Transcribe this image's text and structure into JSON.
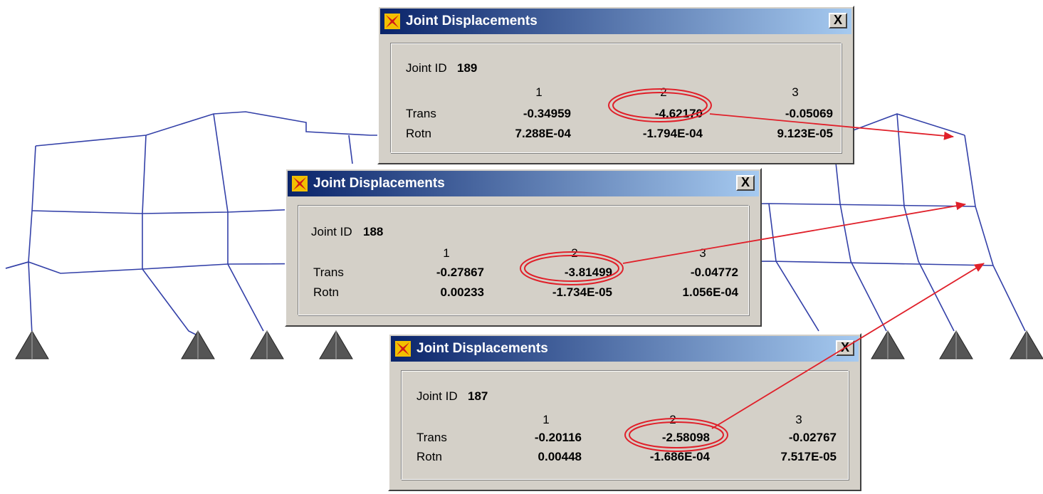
{
  "colors": {
    "frame_line": "#3340a8",
    "support": "#555555",
    "arrow": "#e0202a",
    "dialog_bg": "#d4d0c8",
    "title_start": "#0a246a",
    "title_end": "#a6caf0"
  },
  "icons": {
    "app": "sap2000-app-icon",
    "close": "close-icon"
  },
  "dialogs": [
    {
      "title": "Joint Displacements",
      "close_label": "X",
      "joint_label": "Joint ID",
      "joint_id": "189",
      "col_headers": [
        "1",
        "2",
        "3"
      ],
      "trans_label": "Trans",
      "rotn_label": "Rotn",
      "trans": [
        "-0.34959",
        "-4.62170",
        "-0.05069"
      ],
      "rotn": [
        "7.288E-04",
        "-1.794E-04",
        "9.123E-05"
      ]
    },
    {
      "title": "Joint Displacements",
      "close_label": "X",
      "joint_label": "Joint ID",
      "joint_id": "188",
      "col_headers": [
        "1",
        "2",
        "3"
      ],
      "trans_label": "Trans",
      "rotn_label": "Rotn",
      "trans": [
        "-0.27867",
        "-3.81499",
        "-0.04772"
      ],
      "rotn": [
        "0.00233",
        "-1.734E-05",
        "1.056E-04"
      ]
    },
    {
      "title": "Joint Displacements",
      "close_label": "X",
      "joint_label": "Joint ID",
      "joint_id": "187",
      "col_headers": [
        "1",
        "2",
        "3"
      ],
      "trans_label": "Trans",
      "rotn_label": "Rotn",
      "trans": [
        "-0.20116",
        "-2.58098",
        "-0.02767"
      ],
      "rotn": [
        "0.00448",
        "-1.686E-04",
        "7.517E-05"
      ]
    }
  ]
}
